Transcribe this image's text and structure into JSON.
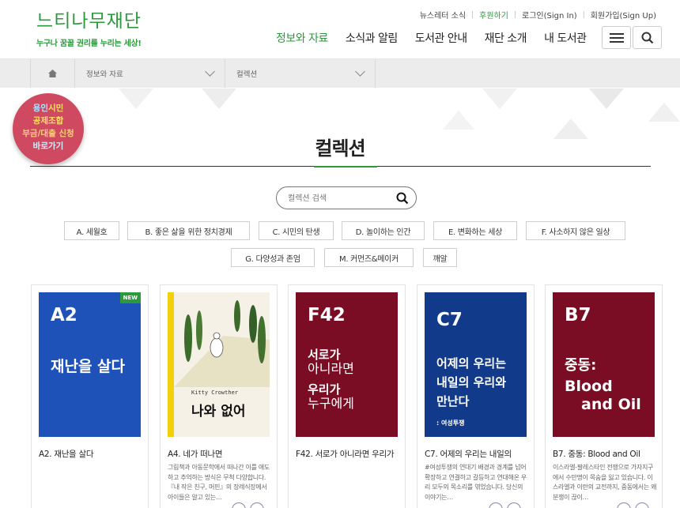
{
  "logo": {
    "main": "느티나무재단",
    "tagline": "누구나 꿈꿀 권리를 누리는 세상!"
  },
  "util_links": [
    "뉴스레터 소식",
    "후원하기",
    "로그인(Sign In)",
    "회원가입(Sign Up)"
  ],
  "gnb": [
    "정보와 자료",
    "소식과 알림",
    "도서관 안내",
    "재단 소개",
    "내 도서관"
  ],
  "breadcrumb": {
    "level1": "정보와 자료",
    "level2": "컬렉션"
  },
  "badge": {
    "line1a": "용인",
    "line1b": "시민",
    "line2": "공제조합",
    "line3": "부금/대출 신청",
    "line4": "바로가기"
  },
  "page_title": "컬렉션",
  "search": {
    "placeholder": "컬렉션 검색"
  },
  "categories": [
    "A. 세월호",
    "B. 좋은 삶을 위한 정치경제",
    "C. 시민의 탄생",
    "D. 놀이하는 인간",
    "E. 변화하는 세상",
    "F. 사소하지 않은 일상",
    "G. 다양성과 존엄",
    "M. 커먼즈&메이커",
    "깨알"
  ],
  "cards": [
    {
      "code": "A2",
      "cover_title": "재난을 살다",
      "badge": "NEW",
      "name": "A2. 재난을 살다",
      "desc": "",
      "color": "#1f52b8"
    },
    {
      "cover_author": "Kitty Crowther",
      "cover_title": "나와 없어",
      "name": "A4. 네가 떠나면",
      "desc": "그림책과 아동문학에서 떠나간 이를 애도하고 추억하는 방식은 무척 다양합니다. 『내 작은 친구, 머핀』의 장례식장에서 아이들은 알고 있는…",
      "color": "#f5f1e6"
    },
    {
      "code": "F42",
      "cover_title_a": "서로가",
      "cover_title_b": "아니라면",
      "cover_title_c": "우리가",
      "cover_title_d": "누구에게",
      "name": "F42. 서로가 아니라면 우리가",
      "desc": "",
      "color": "#7a0d24"
    },
    {
      "code": "C7",
      "cover_title": "어제의 우리는 내일의 우리와 만난다",
      "cover_sub": ": 여성투쟁",
      "name": "C7. 어제의 우리는 내일의",
      "desc": "#여성투쟁의 연대기 배경과 경계를 넘어 확장하고 연결하고 갈등하고 연대해온 우리 모두의 목소리를 엮었습니다. 당신의 이야기는…",
      "color": "#123a8a"
    },
    {
      "code": "B7",
      "cover_title_a": "중동:",
      "cover_title_b": "Blood",
      "cover_title_c": "and Oil",
      "name": "B7. 중동: Blood and Oil",
      "desc": "이스라엘-팔레스타인 전쟁으로 가자지구에서 수만명이 목숨을 잃고 있습니다. 이스라엘과 이란의 교전까지, 중동에서는 왜 분쟁이 끊이…",
      "color": "#7a0d24"
    }
  ],
  "colors": {
    "brand_green": "#2c9a3c",
    "badge_pink": "#cf4a61"
  }
}
